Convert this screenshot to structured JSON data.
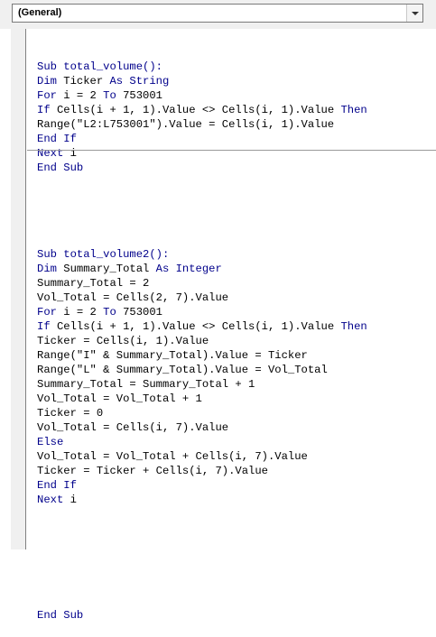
{
  "window": {
    "procedure_dropdown_value": "(General)"
  },
  "code": {
    "block1": [
      [
        {
          "t": "Sub total_volume():",
          "kw": true
        }
      ],
      [
        {
          "t": "Dim",
          "kw": true
        },
        {
          "t": " Ticker ",
          "kw": false
        },
        {
          "t": "As String",
          "kw": true
        }
      ],
      [
        {
          "t": "For",
          "kw": true
        },
        {
          "t": " i = 2 ",
          "kw": false
        },
        {
          "t": "To",
          "kw": true
        },
        {
          "t": " 753001",
          "kw": false
        }
      ],
      [
        {
          "t": "If",
          "kw": true
        },
        {
          "t": " Cells(i + 1, 1).Value <> Cells(i, 1).Value ",
          "kw": false
        },
        {
          "t": "Then",
          "kw": true
        }
      ],
      [
        {
          "t": "Range(\"L2:L753001\").Value = Cells(i, 1).Value",
          "kw": false
        }
      ],
      [
        {
          "t": "End If",
          "kw": true
        }
      ],
      [
        {
          "t": "Next",
          "kw": true
        },
        {
          "t": " i",
          "kw": false
        }
      ],
      [
        {
          "t": "End Sub",
          "kw": true
        }
      ]
    ],
    "block2": [
      [
        {
          "t": "Sub total_volume2():",
          "kw": true
        }
      ],
      [
        {
          "t": "Dim",
          "kw": true
        },
        {
          "t": " Summary_Total ",
          "kw": false
        },
        {
          "t": "As Integer",
          "kw": true
        }
      ],
      [
        {
          "t": "Summary_Total = 2",
          "kw": false
        }
      ],
      [
        {
          "t": "Vol_Total = Cells(2, 7).Value",
          "kw": false
        }
      ],
      [
        {
          "t": "For",
          "kw": true
        },
        {
          "t": " i = 2 ",
          "kw": false
        },
        {
          "t": "To",
          "kw": true
        },
        {
          "t": " 753001",
          "kw": false
        }
      ],
      [
        {
          "t": "If",
          "kw": true
        },
        {
          "t": " Cells(i + 1, 1).Value <> Cells(i, 1).Value ",
          "kw": false
        },
        {
          "t": "Then",
          "kw": true
        }
      ],
      [
        {
          "t": "Ticker = Cells(i, 1).Value",
          "kw": false
        }
      ],
      [
        {
          "t": "Range(\"I\" & Summary_Total).Value = Ticker",
          "kw": false
        }
      ],
      [
        {
          "t": "Range(\"L\" & Summary_Total).Value = Vol_Total",
          "kw": false
        }
      ],
      [
        {
          "t": "Summary_Total = Summary_Total + 1",
          "kw": false
        }
      ],
      [
        {
          "t": "Vol_Total = Vol_Total + 1",
          "kw": false
        }
      ],
      [
        {
          "t": "Ticker = 0",
          "kw": false
        }
      ],
      [
        {
          "t": "Vol_Total = Cells(i, 7).Value",
          "kw": false
        }
      ],
      [
        {
          "t": "Else",
          "kw": true
        }
      ],
      [
        {
          "t": "Vol_Total = Vol_Total + Cells(i, 7).Value",
          "kw": false
        }
      ],
      [
        {
          "t": "Ticker = Ticker + Cells(i, 7).Value",
          "kw": false
        }
      ],
      [
        {
          "t": "End If",
          "kw": true
        }
      ],
      [
        {
          "t": "Next",
          "kw": true
        },
        {
          "t": " i",
          "kw": false
        }
      ],
      [
        {
          "t": "",
          "kw": false
        }
      ],
      [
        {
          "t": "",
          "kw": false
        }
      ],
      [
        {
          "t": "",
          "kw": false
        }
      ],
      [
        {
          "t": "",
          "kw": false
        }
      ],
      [
        {
          "t": "",
          "kw": false
        }
      ],
      [
        {
          "t": "",
          "kw": false
        }
      ],
      [
        {
          "t": "",
          "kw": false
        }
      ],
      [
        {
          "t": "End Sub",
          "kw": true
        }
      ]
    ]
  },
  "colors": {
    "keyword": "#00008b",
    "text": "#000000"
  }
}
